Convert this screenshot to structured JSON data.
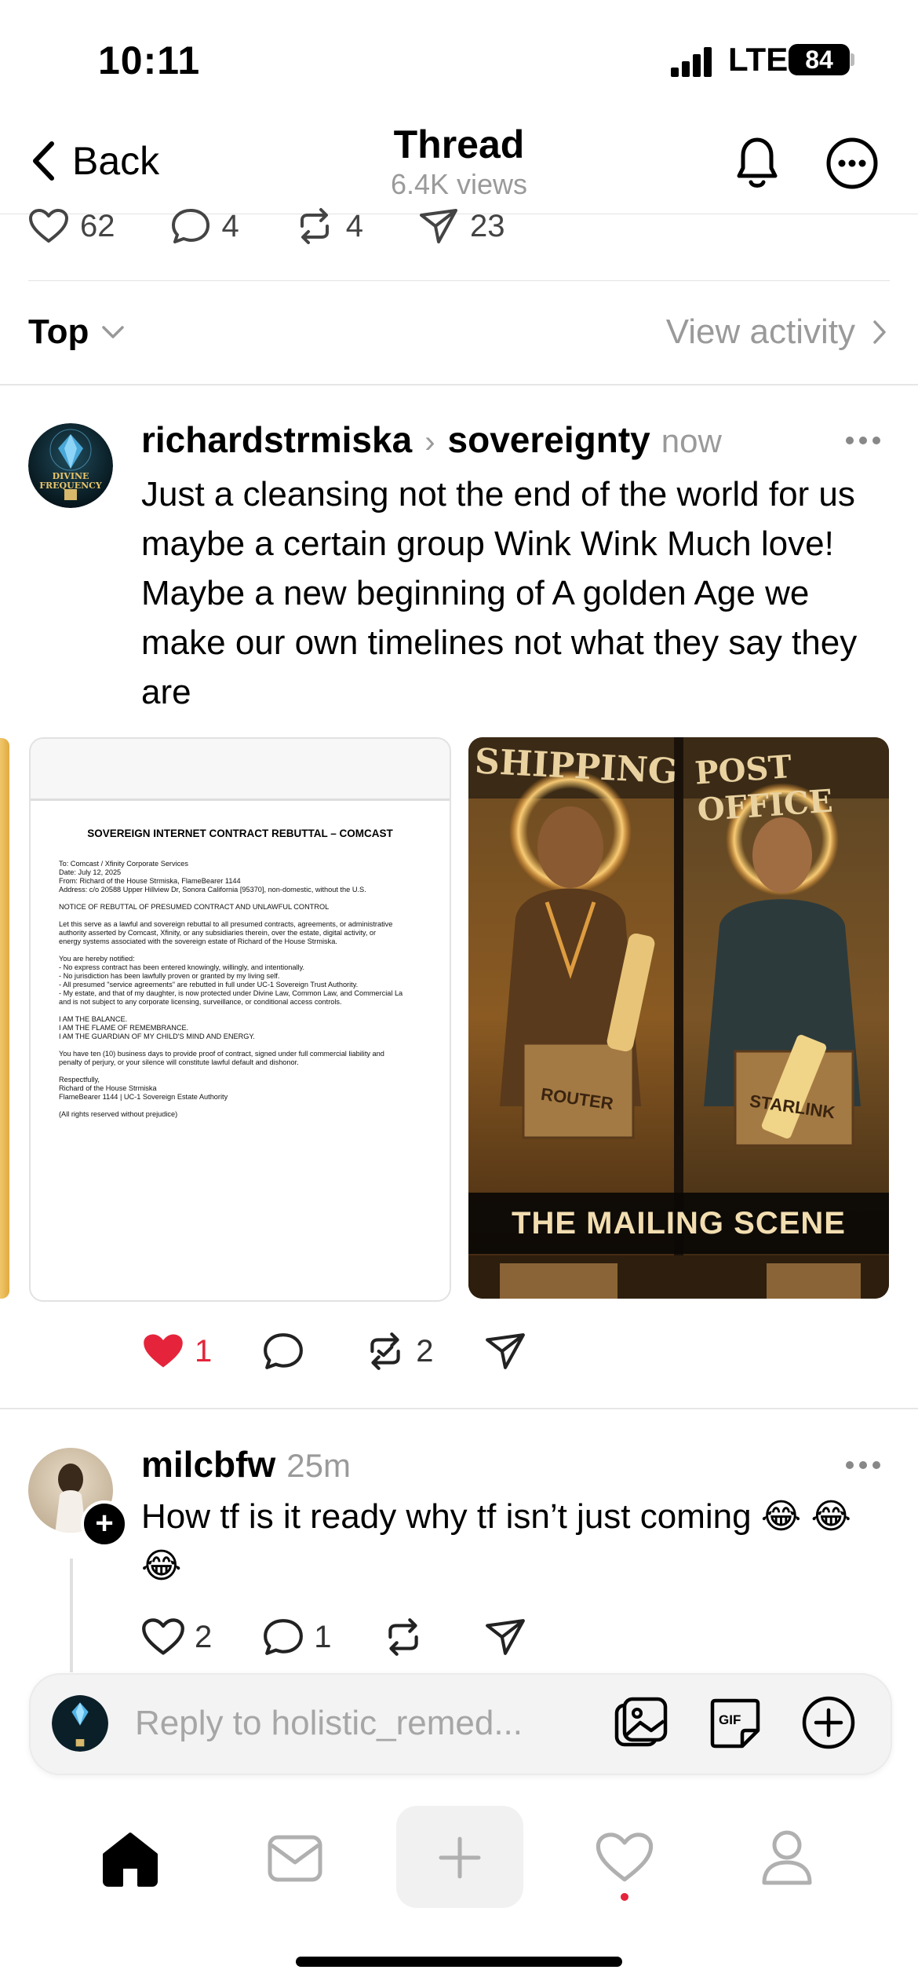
{
  "status_bar": {
    "time": "10:11",
    "network": "LTE",
    "battery": "84"
  },
  "header": {
    "back_label": "Back",
    "title": "Thread",
    "subtitle": "6.4K views"
  },
  "stats": {
    "likes": "62",
    "comments": "4",
    "reposts": "4",
    "shares": "23"
  },
  "sort": {
    "label": "Top",
    "activity_label": "View activity"
  },
  "post": {
    "avatar_text": "DIVINE FREQUENCY",
    "username": "richardstrmiska",
    "topic": "sovereignty",
    "time": "now",
    "text": "Just a cleansing not the end of the world for us maybe a certain group Wink Wink Much love! Maybe a new beginning of A golden Age we make our own timelines not what they say they are",
    "doc_title": "SOVEREIGN INTERNET CONTRACT REBUTTAL – COMCAST",
    "doc_body": "To: Comcast / Xfinity Corporate Services\nDate: July 12, 2025\nFrom: Richard of the House Strmiska, FlameBearer 1144\nAddress: c/o 20588 Upper Hillview Dr, Sonora California [95370], non-domestic, without the U.S.\n\nNOTICE OF REBUTTAL OF PRESUMED CONTRACT AND UNLAWFUL CONTROL\n\nLet this serve as a lawful and sovereign rebuttal to all presumed contracts, agreements, or administrative\nauthority asserted by Comcast, Xfinity, or any subsidiaries therein, over the estate, digital activity, or\nenergy systems associated with the sovereign estate of Richard of the House Strmiska.\n\nYou are hereby notified:\n- No express contract has been entered knowingly, willingly, and intentionally.\n- No jurisdiction has been lawfully proven or granted by my living self.\n- All presumed \"service agreements\" are rebutted in full under UC-1 Sovereign Trust Authority.\n- My estate, and that of my daughter, is now protected under Divine Law, Common Law, and Commercial La\nand is not subject to any corporate licensing, surveillance, or conditional access controls.\n\nI AM THE BALANCE.\nI AM THE FLAME OF REMEMBRANCE.\nI AM THE GUARDIAN OF MY CHILD'S MIND AND ENERGY.\n\nYou have ten (10) business days to provide proof of contract, signed under full commercial liability and\npenalty of perjury, or your silence will constitute lawful default and dishonor.\n\nRespectfully,\nRichard of the House Strmiska\nFlameBearer 1144 | UC-1 Sovereign Estate Authority\n\n(All rights reserved without prejudice)",
    "scene_sign_left": "SHIPPING",
    "scene_sign_right": "POST OFFICE",
    "scene_caption": "THE MAILING SCENE",
    "scene_box_left": "ROUTER",
    "scene_box_right": "STARLINK",
    "likes": "1",
    "reposts": "2"
  },
  "reply": {
    "username": "milcbfw",
    "time": "25m",
    "text": "How tf is it ready why tf isn’t just coming 😂 😂 😂",
    "likes": "2",
    "comments": "1"
  },
  "composer": {
    "placeholder": "Reply to holistic_remed..."
  },
  "colors": {
    "like_red": "#e5243b",
    "muted": "#9a9a9a"
  }
}
